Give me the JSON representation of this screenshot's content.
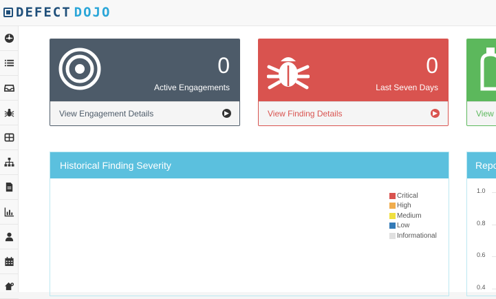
{
  "header": {
    "logo_left": "DEFECT",
    "logo_right": "DOJO"
  },
  "sidebar": {
    "items": [
      {
        "icon": "dashboard-icon"
      },
      {
        "icon": "list-icon"
      },
      {
        "icon": "inbox-icon"
      },
      {
        "icon": "bug-icon"
      },
      {
        "icon": "grid-icon"
      },
      {
        "icon": "sitemap-icon"
      },
      {
        "icon": "file-icon"
      },
      {
        "icon": "bar-chart-icon"
      },
      {
        "icon": "user-icon"
      },
      {
        "icon": "calendar-icon"
      },
      {
        "icon": "home-settings-icon"
      }
    ]
  },
  "panels": {
    "engagements": {
      "count": "0",
      "label": "Active Engagements",
      "link": "View Engagement Details",
      "color": "#4d5b69"
    },
    "findings": {
      "count": "0",
      "label": "Last Seven Days",
      "link": "View Finding Details",
      "color": "#d9534f"
    },
    "third": {
      "link": "View",
      "color": "#5cb85c"
    }
  },
  "chart": {
    "title": "Historical Finding Severity",
    "legend": [
      {
        "label": "Critical",
        "color": "#d9534f"
      },
      {
        "label": "High",
        "color": "#f0ad4e"
      },
      {
        "label": "Medium",
        "color": "#f0e040"
      },
      {
        "label": "Low",
        "color": "#337ab7"
      },
      {
        "label": "Informational",
        "color": "#e0e0e0"
      }
    ]
  },
  "report": {
    "title": "Repo",
    "yticks": [
      "1.0",
      "0.8",
      "0.6",
      "0.4"
    ]
  }
}
